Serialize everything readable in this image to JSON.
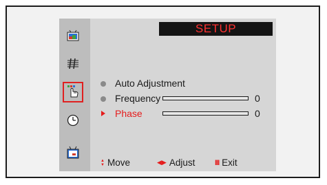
{
  "osd": {
    "title": "SETUP",
    "sidebar": [
      {
        "name": "picture-icon",
        "selected": false
      },
      {
        "name": "sound-icon",
        "selected": false
      },
      {
        "name": "setup-hand-icon",
        "selected": true
      },
      {
        "name": "clock-icon",
        "selected": false
      },
      {
        "name": "tv-input-icon",
        "selected": false
      }
    ],
    "items": [
      {
        "label": "Auto Adjustment",
        "value": "",
        "active": false
      },
      {
        "label": "Frequency",
        "value": "0",
        "level": 0,
        "active": false
      },
      {
        "label": "Phase",
        "value": "0",
        "level": 0,
        "active": true
      }
    ],
    "footer": {
      "move_glyph": "▲▼",
      "move_label": "Move",
      "adjust_glyph": "◀▶",
      "adjust_label": "Adjust",
      "exit_glyph": "III",
      "exit_label": "Exit"
    },
    "colors": {
      "title_bg": "#141414",
      "title_text": "#ff3030",
      "active_text": "#e51c1c",
      "selection_border": "#e02020"
    }
  }
}
